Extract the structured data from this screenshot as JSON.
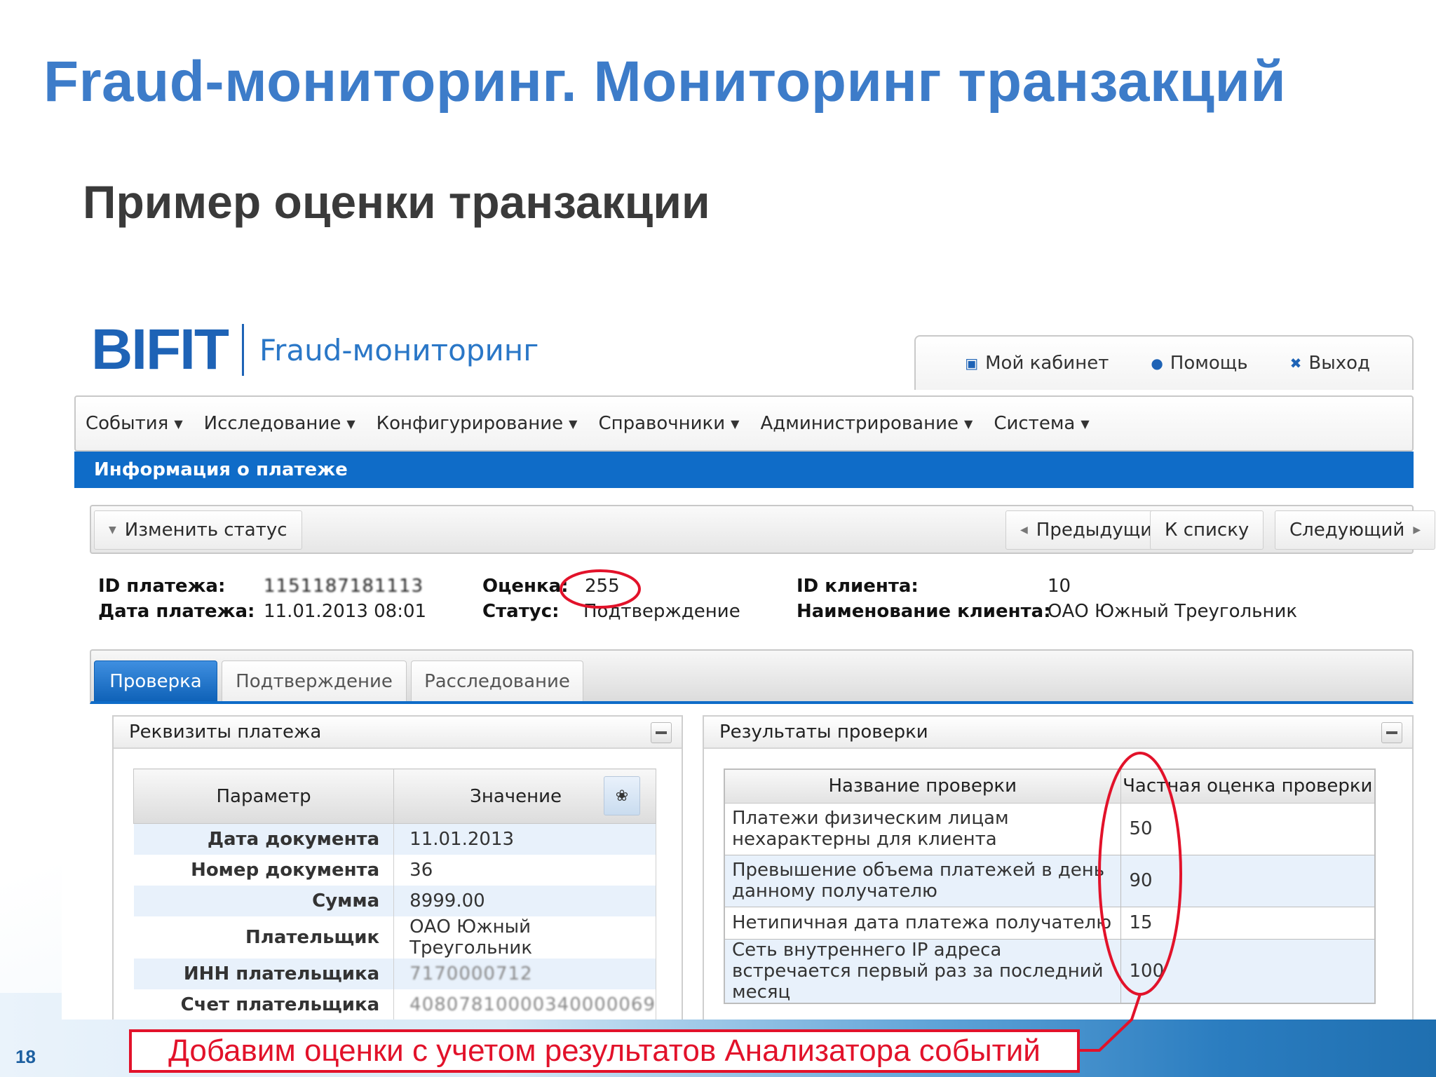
{
  "slide": {
    "title": "Fraud-мониторинг. Мониторинг транзакций",
    "subtitle": "Пример оценки транзакции",
    "page_number": "18",
    "callout": "Добавим оценки с учетом результатов Анализатора событий",
    "accent_color": "#3d7cc9",
    "callout_color": "#e2122a"
  },
  "app": {
    "logo": {
      "mark": "BIFIT",
      "product": "Fraud-мониторинг"
    },
    "user_menu": [
      {
        "label": "Мой кабинет",
        "icon": "cabinet-icon"
      },
      {
        "label": "Помощь",
        "icon": "info-icon"
      },
      {
        "label": "Выход",
        "icon": "close-icon"
      }
    ],
    "menu": [
      "События",
      "Исследование",
      "Конфигурирование",
      "Справочники",
      "Администрирование",
      "Система"
    ],
    "section_title": "Информация о платеже",
    "toolbar": {
      "change_status": "Изменить статус",
      "prev": "Предыдущий",
      "to_list": "К списку",
      "next": "Следующий"
    },
    "payment_info": {
      "id_label": "ID платежа:",
      "id_value": "1151187181113",
      "date_label": "Дата платежа:",
      "date_value": "11.01.2013 08:01",
      "score_label": "Оценка:",
      "score_value": "255",
      "status_label": "Статус:",
      "status_value": "Подтверждение",
      "client_id_label": "ID клиента:",
      "client_id_value": "10",
      "client_name_label": "Наименование клиента:",
      "client_name_value": "ОАО Южный Треугольник"
    },
    "tabs": [
      "Проверка",
      "Подтверждение",
      "Расследование"
    ],
    "details_panel": {
      "title": "Реквизиты платежа",
      "columns": [
        "Параметр",
        "Значение"
      ],
      "rows": [
        {
          "param": "Дата документа",
          "value": "11.01.2013"
        },
        {
          "param": "Номер документа",
          "value": "36"
        },
        {
          "param": "Сумма",
          "value": "8999.00"
        },
        {
          "param": "Плательщик",
          "value": "ОАО Южный Треугольник"
        },
        {
          "param": "ИНН плательщика",
          "value": "7170000712"
        },
        {
          "param": "Счет плательщика",
          "value": "40807810000340000069"
        }
      ]
    },
    "checks_panel": {
      "title": "Результаты проверки",
      "columns": [
        "Название проверки",
        "Частная оценка проверки"
      ],
      "rows": [
        {
          "name": "Платежи физическим лицам нехарактерны для клиента",
          "score": "50"
        },
        {
          "name": "Превышение объема платежей в день данному получателю",
          "score": "90"
        },
        {
          "name": "Нетипичная дата платежа получателю",
          "score": "15"
        },
        {
          "name": "Сеть внутреннего IP адреса встречается первый раз за последний месяц",
          "score": "100"
        }
      ]
    }
  }
}
